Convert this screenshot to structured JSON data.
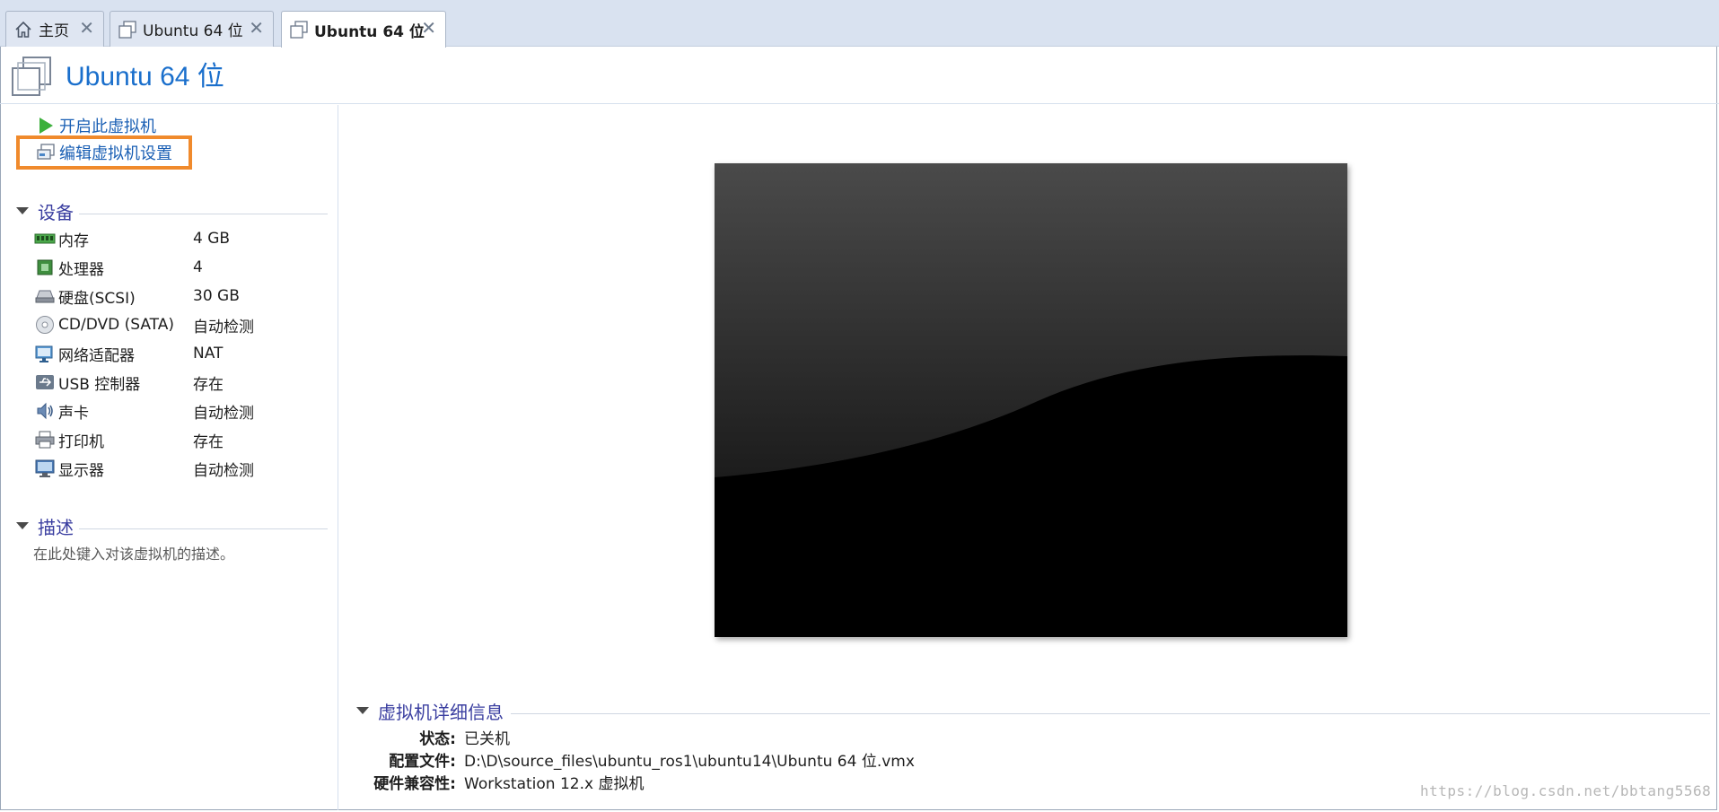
{
  "tabs": [
    {
      "label": "主页",
      "icon": "home-icon",
      "active": false
    },
    {
      "label": "Ubuntu 64 位",
      "icon": "vm-icon",
      "active": false
    },
    {
      "label": "Ubuntu 64 位",
      "icon": "vm-icon",
      "active": true
    }
  ],
  "title": "Ubuntu 64 位",
  "actions": {
    "power_on": "开启此虚拟机",
    "edit_settings": "编辑虚拟机设置"
  },
  "devices_section": {
    "title": "设备",
    "items": [
      {
        "name": "内存",
        "value": "4 GB",
        "icon": "memory-icon"
      },
      {
        "name": "处理器",
        "value": "4",
        "icon": "processor-icon"
      },
      {
        "name": "硬盘(SCSI)",
        "value": "30 GB",
        "icon": "hard-disk-icon"
      },
      {
        "name": "CD/DVD (SATA)",
        "value": "自动检测",
        "icon": "cd-dvd-icon"
      },
      {
        "name": "网络适配器",
        "value": "NAT",
        "icon": "network-adapter-icon"
      },
      {
        "name": "USB 控制器",
        "value": "存在",
        "icon": "usb-icon"
      },
      {
        "name": "声卡",
        "value": "自动检测",
        "icon": "sound-card-icon"
      },
      {
        "name": "打印机",
        "value": "存在",
        "icon": "printer-icon"
      },
      {
        "name": "显示器",
        "value": "自动检测",
        "icon": "display-icon"
      }
    ]
  },
  "description_section": {
    "title": "描述",
    "placeholder": "在此处键入对该虚拟机的描述。"
  },
  "details_section": {
    "title": "虚拟机详细信息",
    "rows": [
      {
        "key": "状态:",
        "value": "已关机"
      },
      {
        "key": "配置文件:",
        "value": "D:\\D\\source_files\\ubuntu_ros1\\ubuntu14\\Ubuntu 64 位.vmx"
      },
      {
        "key": "硬件兼容性:",
        "value": "Workstation 12.x 虚拟机"
      }
    ]
  },
  "watermark": "https://blog.csdn.net/bbtang5568",
  "colors": {
    "accent_blue": "#1a6fcc",
    "section_purple": "#3a3ea0",
    "highlight_orange": "#f08a2c"
  }
}
